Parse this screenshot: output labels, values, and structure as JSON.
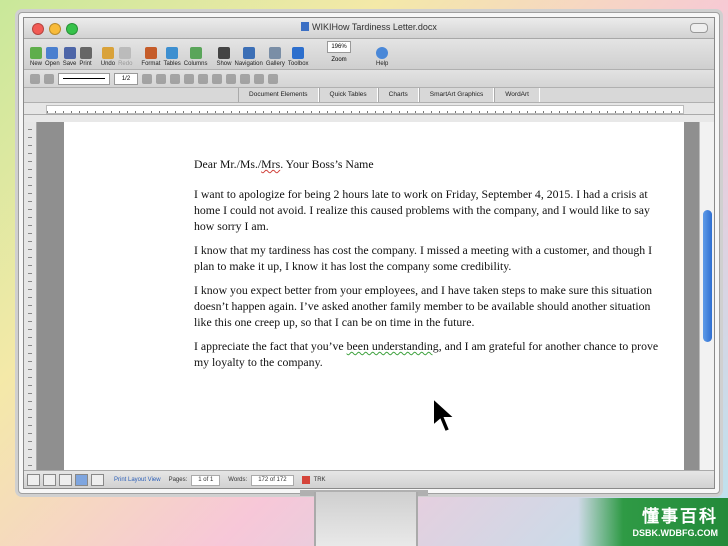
{
  "window": {
    "title": "WIKIHow Tardiness Letter.docx"
  },
  "toolbar": {
    "items": [
      "New",
      "Open",
      "Save",
      "Print",
      "Undo",
      "Redo",
      "Format",
      "Tables",
      "Columns",
      "Show",
      "Navigation",
      "Gallery",
      "Toolbox",
      "Zoom",
      "Help"
    ],
    "zoom_value": "196%",
    "line_weight": "1/2"
  },
  "ribbon": {
    "tabs": [
      "Document Elements",
      "Quick Tables",
      "Charts",
      "SmartArt Graphics",
      "WordArt"
    ]
  },
  "document": {
    "salutation_prefix": "Dear Mr./Ms./",
    "salutation_flagged": "Mrs",
    "salutation_suffix": ". Your Boss’s Name",
    "p1": "I want to apologize for being 2 hours late to work on Friday, September 4, 2015. I had a crisis at home I could not avoid. I realize this caused problems with the company, and I would like to say how sorry I am.",
    "p2": "I know that my tardiness has cost the company. I missed a meeting with a customer, and though I plan to make it up, I know it has lost the company some credibility.",
    "p3": "I know you expect better from your employees, and I have taken steps to make sure this situation doesn’t happen again. I’ve asked another family member to be available should another situation like this one creep up, so that I can be on time in the future.",
    "p4_prefix": "I appreciate the fact that you’ve ",
    "p4_flagged": "been understanding",
    "p4_suffix": ", and I am grateful for another chance to prove my loyalty to the company."
  },
  "status": {
    "view": "Print Layout View",
    "pages_label": "Pages:",
    "pages_value": "1 of 1",
    "words_label": "Words:",
    "words_value": "172 of 172",
    "trk": "TRK"
  },
  "watermark": {
    "brand_cn": "懂事百科",
    "brand_url": "DSBK.WDBFG.COM"
  }
}
